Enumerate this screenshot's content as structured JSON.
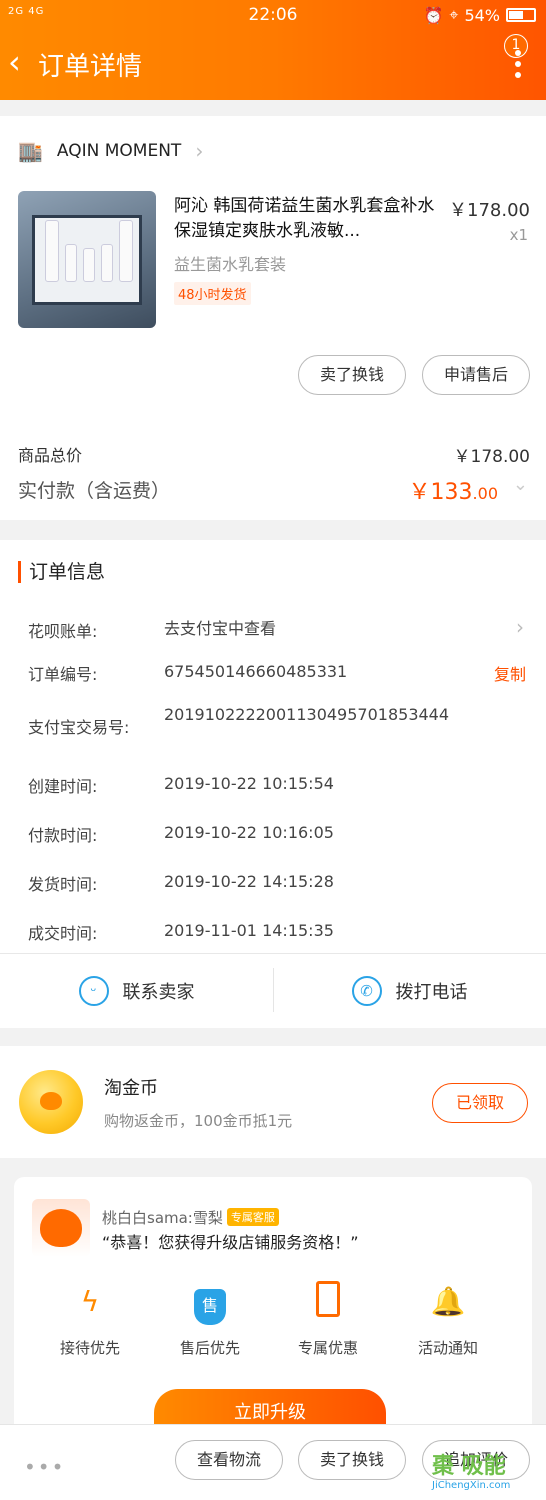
{
  "status_bar": {
    "signal": "2G 4G",
    "time": "22:06",
    "battery": "54%"
  },
  "header": {
    "title": "订单详情",
    "badge": "1"
  },
  "shop": {
    "name": "AQIN MOMENT"
  },
  "product": {
    "title": "阿沁 韩国荷诺益生菌水乳套盒补水保湿镇定爽肤水乳液敏...",
    "price": "￥178.00",
    "qty": "x1",
    "sku": "益生菌水乳套装",
    "ship_tag": "48小时发货"
  },
  "actions": {
    "sell": "卖了换钱",
    "after_sale": "申请售后"
  },
  "summary": {
    "total_label": "商品总价",
    "total_value": "￥178.00",
    "paid_label": "实付款（含运费）",
    "paid_main": "￥133",
    "paid_cents": ".00"
  },
  "order_info": {
    "title": "订单信息",
    "huabei_label": "花呗账单:",
    "huabei_value": "去支付宝中查看",
    "order_no_label": "订单编号:",
    "order_no_value": "675450146660485331",
    "copy": "复制",
    "alipay_label": "支付宝交易号:",
    "alipay_value": "2019102222001130495701853444",
    "created_label": "创建时间:",
    "created_value": "2019-10-22 10:15:54",
    "paid_label": "付款时间:",
    "paid_value": "2019-10-22 10:16:05",
    "shipped_label": "发货时间:",
    "shipped_value": "2019-10-22 14:15:28",
    "closed_label": "成交时间:",
    "closed_value": "2019-11-01 14:15:35"
  },
  "contact": {
    "seller": "联系卖家",
    "phone": "拨打电话"
  },
  "coins": {
    "title": "淘金币",
    "subtitle": "购物返金币，100金币抵1元",
    "button": "已领取"
  },
  "service": {
    "name": "桃白白sama:雪梨",
    "tag": "专属客服",
    "message": "“恭喜！您获得升级店铺服务资格！”",
    "perks": [
      "接待优先",
      "售后优先",
      "专属优惠",
      "活动通知"
    ],
    "upgrade": "立即升级"
  },
  "bottom_bar": {
    "logistics": "查看物流",
    "sell": "卖了换钱",
    "review": "追加评价"
  },
  "watermark": {
    "text": "JiChengXin.com"
  }
}
